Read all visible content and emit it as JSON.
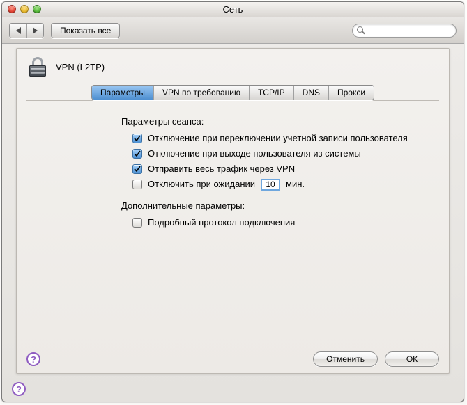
{
  "window": {
    "title": "Сеть"
  },
  "toolbar": {
    "show_all": "Показать все",
    "search_placeholder": ""
  },
  "vpn": {
    "title": "VPN (L2TP)"
  },
  "tabs": {
    "options": "Параметры",
    "on_demand": "VPN по требованию",
    "tcpip": "TCP/IP",
    "dns": "DNS",
    "proxies": "Прокси"
  },
  "session": {
    "title": "Параметры сеанса:",
    "disconnect_on_switch": "Отключение при переключении учетной записи пользователя",
    "disconnect_on_logout": "Отключение при выходе пользователя из системы",
    "send_all_traffic": "Отправить весь трафик через VPN",
    "disconnect_idle_prefix": "Отключить при ожидании",
    "disconnect_idle_value": "10",
    "disconnect_idle_suffix": "мин."
  },
  "advanced": {
    "title": "Дополнительные параметры:",
    "verbose_logging": "Подробный протокол подключения"
  },
  "buttons": {
    "cancel": "Отменить",
    "ok": "ОК"
  }
}
